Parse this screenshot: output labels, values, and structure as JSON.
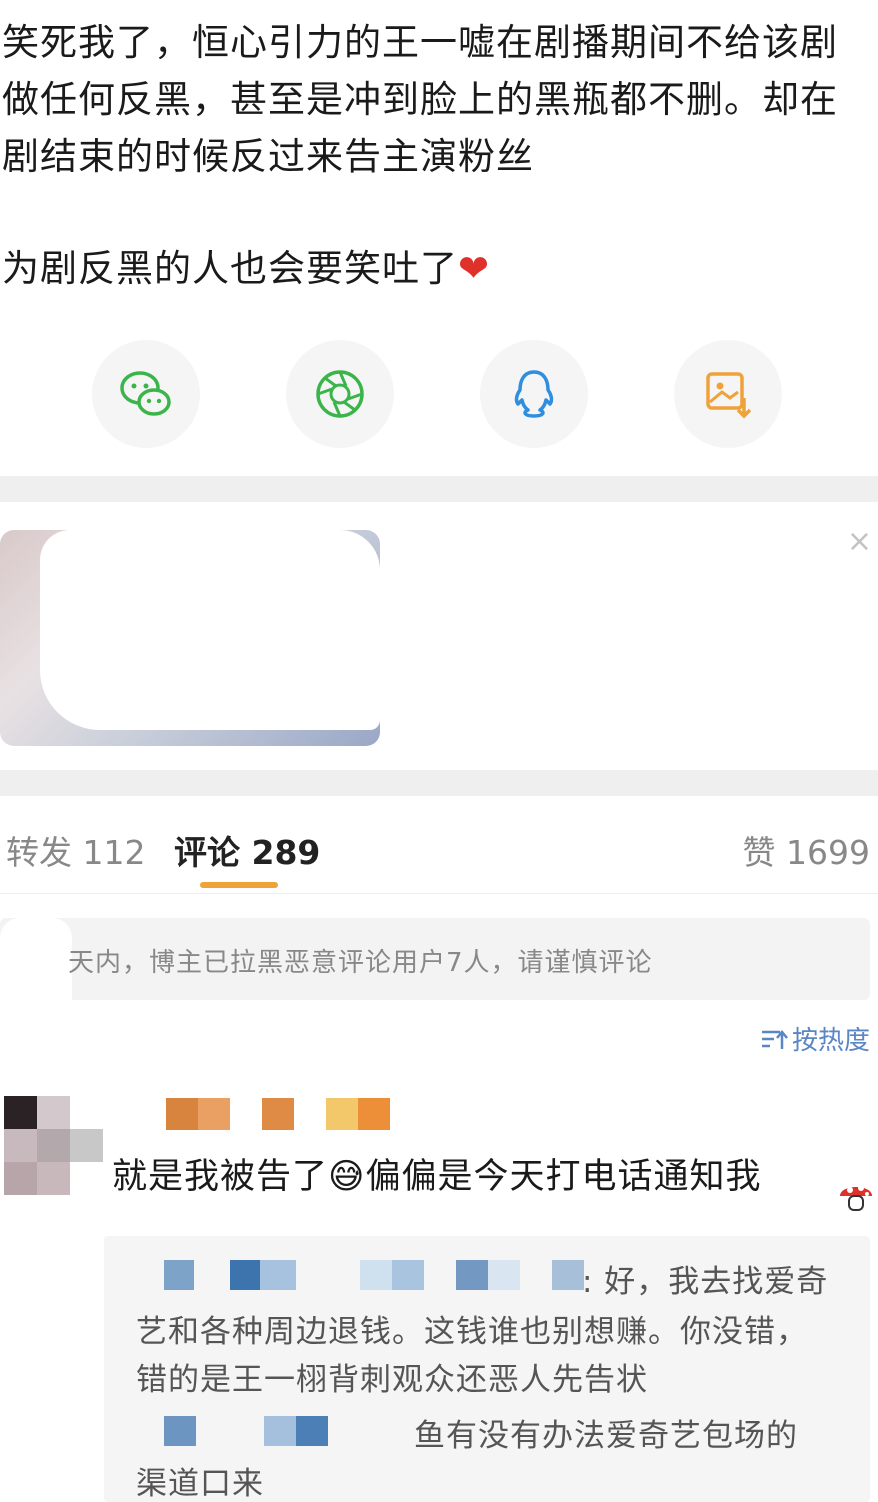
{
  "post": {
    "line1": "笑死我了，恒心引力的王一嘘在剧播期间不给该剧",
    "line2": "做任何反黑，甚至是冲到脸上的黑瓶都不删。却在",
    "line3": "剧结束的时候反过来告主演粉丝",
    "line4": "为剧反黑的人也会要笑吐了",
    "heart": "❤"
  },
  "share": [
    {
      "icon": "wechat-icon"
    },
    {
      "icon": "moments-icon"
    },
    {
      "icon": "qq-icon"
    },
    {
      "icon": "save-image-icon"
    }
  ],
  "ad": {
    "close": "×"
  },
  "tabs": {
    "repost_label": "转发 112",
    "comment_label": "评论 289",
    "like_label": "赞 1699"
  },
  "notice": {
    "text": "天内，博主已拉黑恶意评论用户7人，请谨慎评论"
  },
  "sort": {
    "label": "按热度",
    "icon": "sort-icon"
  },
  "comment": {
    "text": "就是我被告了😅偏偏是今天打电话通知我",
    "reply1_tail": ": 好，我去找爱奇",
    "reply1_line2": "艺和各种周边退钱。这钱谁也别想赚。你没错，",
    "reply1_line3": "错的是王一栩背刺观众还恶人先告状",
    "reply2_tail": "鱼有没有办法爱奇艺包场的",
    "reply2_line2": "渠道口来"
  },
  "colors": {
    "tab_accent": "#f0a23a",
    "link": "#5b86c4",
    "wechat": "#3bb54a",
    "moments": "#3bb54a",
    "qq": "#2f8ee0",
    "save": "#f0a23a"
  }
}
